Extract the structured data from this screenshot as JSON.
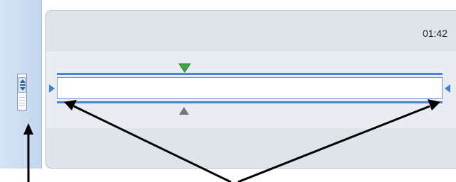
{
  "timeline": {
    "time_display": "01:42",
    "colors": {
      "track_blue": "#4a86cf",
      "play_marker_green": "#3aa847",
      "end_marker_gray": "#777777",
      "panel_bg": "#dfe3ea"
    },
    "icons": {
      "start_marker": "green-down-triangle",
      "end_marker": "gray-up-triangle",
      "left_handle": "blue-right-triangle",
      "right_handle": "blue-left-triangle",
      "scroll_arrows": "up-down-arrows"
    }
  }
}
